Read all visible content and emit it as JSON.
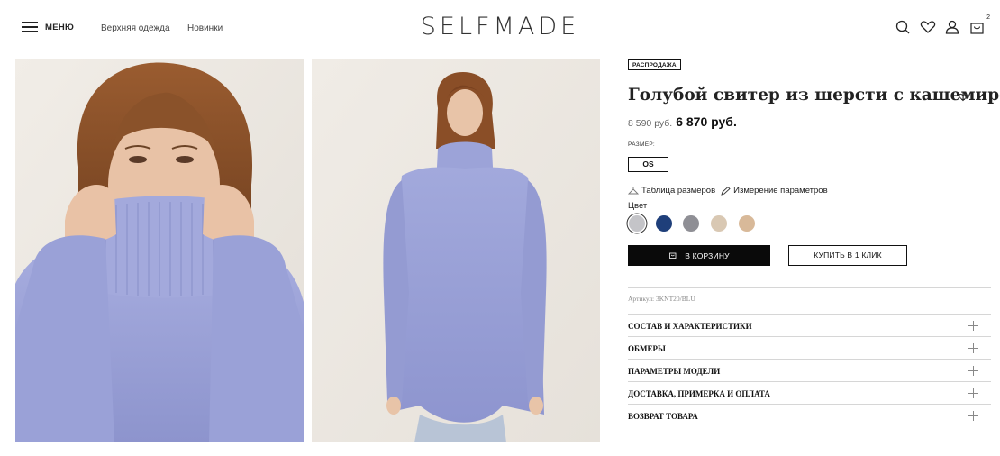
{
  "header": {
    "menu_label": "МЕНЮ",
    "nav": [
      "Верхняя одежда",
      "Новинки"
    ],
    "logo": "SELFMADE",
    "cart_count": "2",
    "icons": [
      "search-icon",
      "heart-icon",
      "user-icon",
      "cart-icon"
    ]
  },
  "product": {
    "badge": "РАСПРОДАЖА",
    "title": "Голубой свитер из шерсти с кашемиром",
    "old_price": "8 590 руб.",
    "new_price": "6 870 руб.",
    "size_label": "РАЗМЕР:",
    "size_value": "OS",
    "size_table_link": "Таблица размеров",
    "measure_link": "Измерение параметров",
    "color_label": "Цвет",
    "colors": [
      "#c4c4c8",
      "#1f3f7a",
      "#8f8f95",
      "#d9c8b3",
      "#d8b999"
    ],
    "selected_color_index": 0,
    "add_to_cart": "В КОРЗИНУ",
    "buy_one_click": "КУПИТЬ В 1 КЛИК",
    "sku": "Артикул: 3KNT20/BLU",
    "accordion": [
      "СОСТАВ И ХАРАКТЕРИСТИКИ",
      "ОБМЕРЫ",
      "ПАРАМЕТРЫ МОДЕЛИ",
      "ДОСТАВКА, ПРИМЕРКА И ОПЛАТА",
      "ВОЗВРАТ ТОВАРА"
    ]
  },
  "colors": {
    "accent": "#0a0a0a",
    "sweater": "#9ea5d8",
    "photo_bg": "#eeeae4"
  }
}
